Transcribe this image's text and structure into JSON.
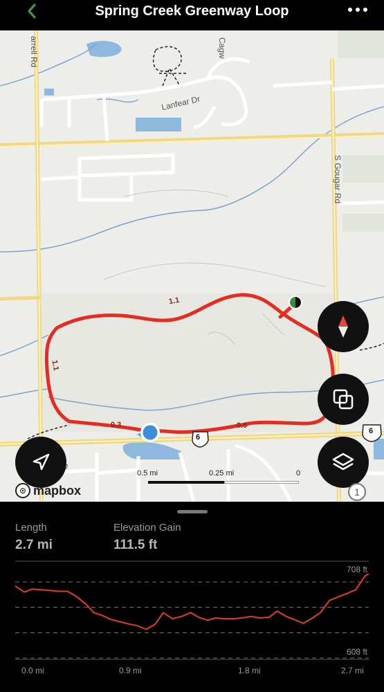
{
  "header": {
    "title": "Spring Creek Greenway Loop"
  },
  "map": {
    "streets": {
      "farrell": "arrell Rd",
      "cagwin": "Cagw",
      "lanfear": "Lanfear Dr",
      "gougar": "S Gougar Rd",
      "bottom_left": "D"
    },
    "route_markers": [
      "1.1",
      "1.1",
      "0.3",
      "0.6"
    ],
    "highway_shield": "6",
    "scale": {
      "left_label": "0.5 mi",
      "mid_label": "0.25 mi",
      "right_label": "0"
    },
    "attribution": {
      "logo_text": "mapbox",
      "info_label": "1"
    }
  },
  "stats": {
    "length_label": "Length",
    "length_value": "2.7 mi",
    "gain_label": "Elevation Gain",
    "gain_value": "111.5 ft"
  },
  "chart_data": {
    "type": "line",
    "xlabel": "",
    "ylabel": "",
    "ylim": [
      608,
      708
    ],
    "xlim": [
      0,
      2.7
    ],
    "x_ticks": [
      "0.0 mi",
      "0.9 mi",
      "1.8 mi",
      "2.7 mi"
    ],
    "y_ticks": [
      "708 ft",
      "608 ft"
    ],
    "grid": true,
    "color": "#e63a2a",
    "series": [
      {
        "x": [
          0,
          0.07,
          0.13,
          0.2,
          0.27,
          0.34,
          0.4,
          0.47,
          0.54,
          0.6,
          0.67,
          0.73,
          0.8,
          0.87,
          0.93,
          1.0,
          1.07,
          1.13,
          1.2,
          1.27,
          1.34,
          1.4,
          1.47,
          1.53,
          1.6,
          1.67,
          1.73,
          1.8,
          1.87,
          1.94,
          2.0,
          2.07,
          2.13,
          2.2,
          2.27,
          2.33,
          2.4,
          2.47,
          2.53,
          2.6,
          2.67,
          2.7
        ],
        "values": [
          690,
          682,
          686,
          685,
          684,
          683,
          683,
          676,
          666,
          655,
          651,
          646,
          643,
          640,
          638,
          633,
          640,
          655,
          647,
          650,
          655,
          649,
          645,
          648,
          647,
          647,
          648,
          650,
          648,
          649,
          657,
          650,
          646,
          641,
          648,
          655,
          671,
          676,
          680,
          685,
          703,
          706
        ]
      }
    ]
  }
}
